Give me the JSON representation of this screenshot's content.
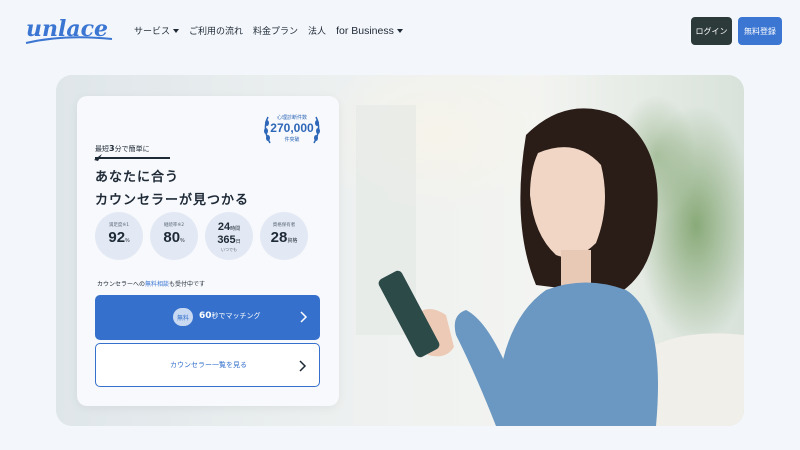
{
  "brand": {
    "logo_text": "unlace",
    "accent": "#3470cc"
  },
  "nav": {
    "items": [
      {
        "label": "サービス",
        "has_caret": true
      },
      {
        "label": "ご利用の流れ",
        "has_caret": false
      },
      {
        "label": "料金プラン",
        "has_caret": false
      },
      {
        "label": "法人",
        "has_caret": false
      },
      {
        "label": "for Business",
        "has_caret": true
      }
    ],
    "login_label": "ログイン",
    "signup_label": "無料登録"
  },
  "card": {
    "badge": {
      "top": "心理診断件数",
      "number": "270,000",
      "bottom": "件突破"
    },
    "eyebrow_pre": "最短",
    "eyebrow_num": "3",
    "eyebrow_post": "分で簡単に",
    "headline_1": "あなたに合う",
    "headline_2": "カウンセラーが見つかる",
    "stats": [
      {
        "label": "満足度※1",
        "value": "92",
        "unit": "%"
      },
      {
        "label": "継続率※2",
        "value": "80",
        "unit": "%"
      },
      {
        "value_1": "24",
        "unit_1": "時間",
        "value_2": "365",
        "unit_2": "日",
        "label": "いつでも"
      },
      {
        "label": "資格保有者",
        "value": "28",
        "unit": "資格"
      }
    ],
    "note_pre": "カウンセラーへの",
    "note_highlight": "無料相談",
    "note_post": "も受付中です",
    "cta_primary": {
      "pill": "無料",
      "number": "60",
      "text": "秒でマッチング"
    },
    "cta_secondary": "カウンセラー一覧を見る"
  }
}
